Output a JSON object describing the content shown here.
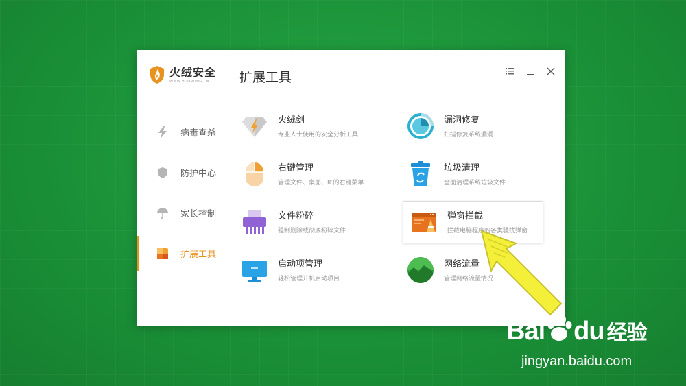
{
  "app": {
    "logo_name": "火绒安全",
    "logo_url": "WWW.HUORONG.CN",
    "page_title": "扩展工具"
  },
  "window_controls": {
    "menu_icon": "menu-icon",
    "minimize_icon": "minimize-icon",
    "close_icon": "close-icon"
  },
  "sidebar": {
    "items": [
      {
        "label": "病毒查杀",
        "icon": "lightning-icon",
        "active": false
      },
      {
        "label": "防护中心",
        "icon": "shield-icon",
        "active": false
      },
      {
        "label": "家长控制",
        "icon": "umbrella-icon",
        "active": false
      },
      {
        "label": "扩展工具",
        "icon": "tools-icon",
        "active": true
      }
    ]
  },
  "tools": [
    {
      "name": "火绒剑",
      "desc": "专业人士使用的安全分析工具",
      "icon": "sword-icon"
    },
    {
      "name": "漏洞修复",
      "desc": "扫描修复系统漏洞",
      "icon": "vulnerability-icon"
    },
    {
      "name": "右键管理",
      "desc": "管理文件、桌面、IE的右键菜单",
      "icon": "right-click-icon"
    },
    {
      "name": "垃圾清理",
      "desc": "全面清理系统垃圾文件",
      "icon": "trash-icon"
    },
    {
      "name": "文件粉碎",
      "desc": "强制删除或彻底粉碎文件",
      "icon": "shredder-icon"
    },
    {
      "name": "弹窗拦截",
      "desc": "拦截电脑程序的各类骚扰弹窗",
      "icon": "popup-block-icon",
      "highlighted": true
    },
    {
      "name": "启动项管理",
      "desc": "轻松管理开机启动项目",
      "icon": "monitor-icon"
    },
    {
      "name": "网络流量",
      "desc": "管理网络流量情况",
      "icon": "network-icon"
    }
  ],
  "watermark": {
    "brand": "Bai",
    "brand_tail": "du",
    "brand_cn": "经验",
    "url": "jingyan.baidu.com"
  },
  "colors": {
    "accent": "#e8931f",
    "background": "#1f9a3c",
    "cursor": "#f4f03a"
  }
}
